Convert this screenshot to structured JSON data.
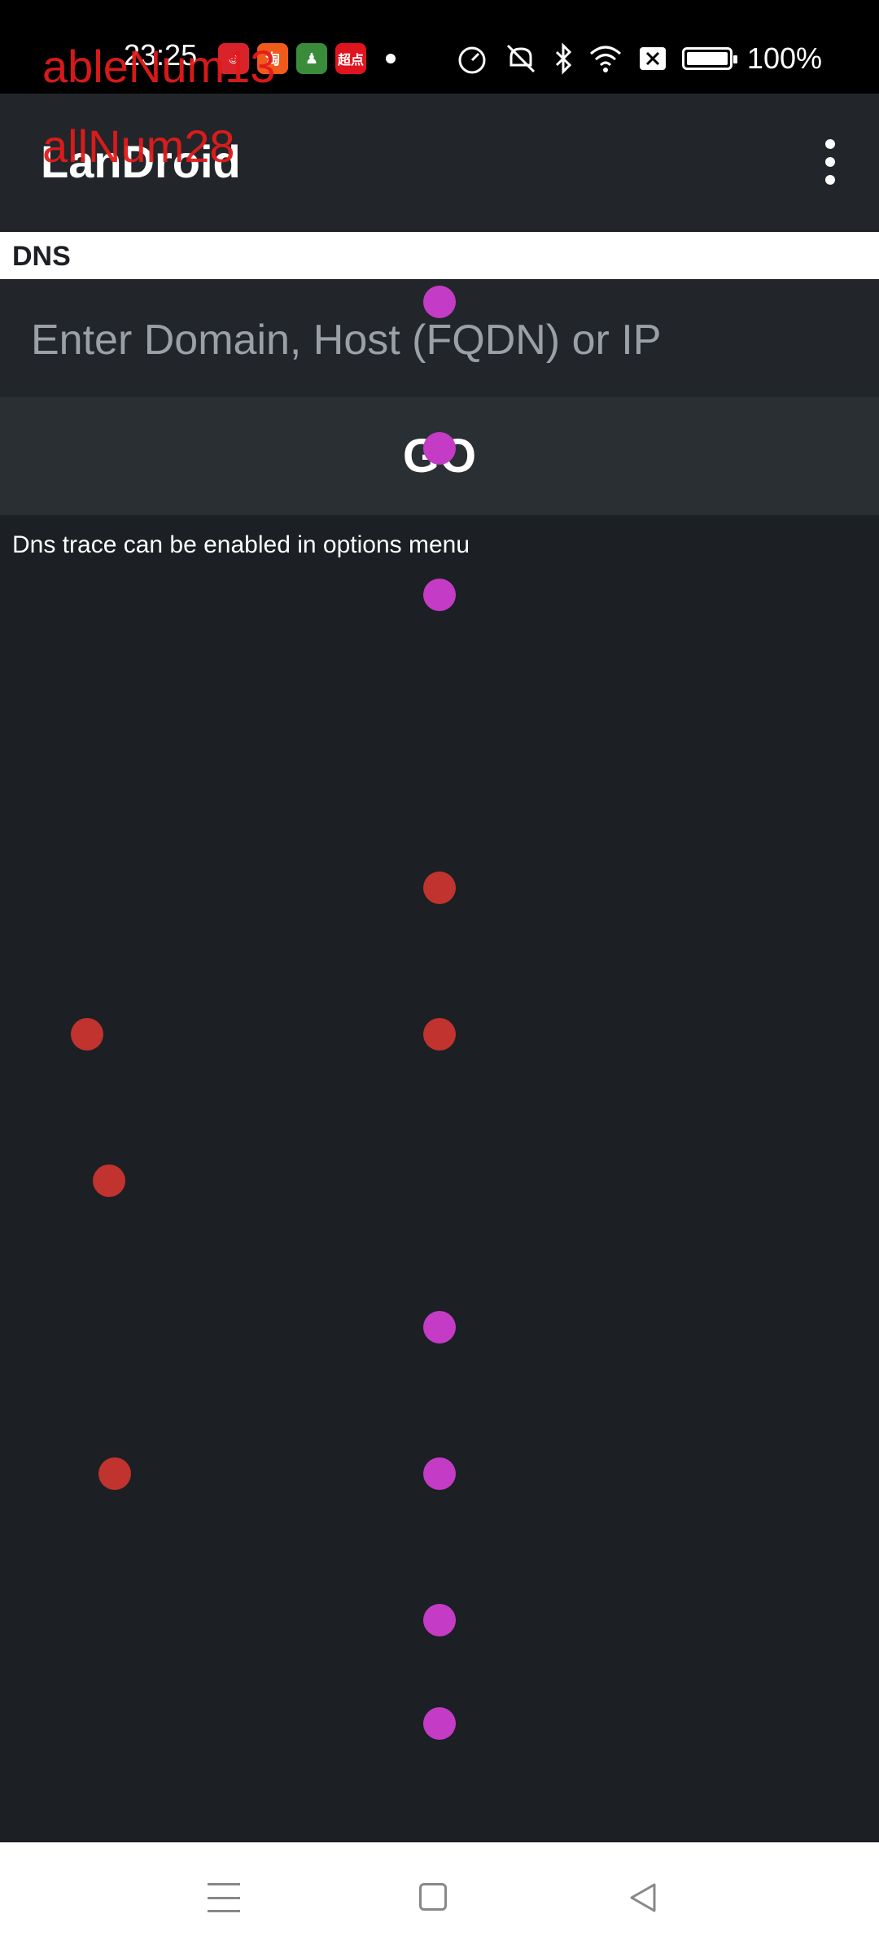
{
  "status_bar": {
    "time": "23:25",
    "battery": "100%",
    "app_icons": [
      "weibo-icon",
      "taobao-icon",
      "game-icon",
      "qidian-icon"
    ],
    "qidian_text": "超点",
    "system_icons": [
      "speedometer-icon",
      "mute-icon",
      "bluetooth-icon",
      "wifi-icon",
      "sim-off-icon",
      "battery-icon"
    ]
  },
  "overlay": {
    "line1": "ableNum13",
    "line2": "allNum28"
  },
  "app_bar": {
    "title": "LanDroid",
    "menu_icon": "kebab-menu-icon"
  },
  "section": {
    "label": "DNS"
  },
  "input": {
    "placeholder": "Enter Domain, Host (FQDN) or IP",
    "value": ""
  },
  "go_button": {
    "label": "GO"
  },
  "hint": {
    "text": "Dns trace can be enabled in options menu"
  },
  "colors": {
    "background": "#1c1f23",
    "app_bar": "#22262a",
    "marker_purple": "#c43bc6",
    "marker_red": "#c0332e",
    "overlay_text": "#e21b1b"
  },
  "nav_bar": {
    "icons": [
      "menu-icon",
      "home-icon",
      "back-icon"
    ]
  }
}
